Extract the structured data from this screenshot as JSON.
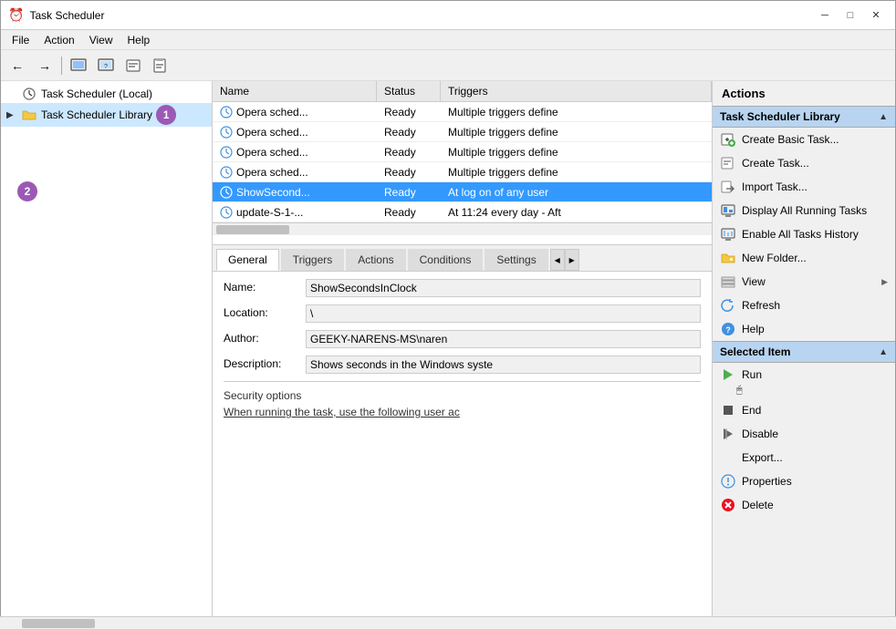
{
  "window": {
    "title": "Task Scheduler",
    "icon": "⏰"
  },
  "menu": {
    "items": [
      "File",
      "Action",
      "View",
      "Help"
    ]
  },
  "toolbar": {
    "back_label": "←",
    "forward_label": "→",
    "btn1": "📁",
    "btn2": "🔷",
    "btn3": "❓",
    "btn4": "📋"
  },
  "tree": {
    "items": [
      {
        "id": "local",
        "label": "Task Scheduler (Local)",
        "level": 0,
        "expandable": false,
        "icon": "clock"
      },
      {
        "id": "library",
        "label": "Task Scheduler Library",
        "level": 1,
        "expandable": true,
        "icon": "folder",
        "selected": true
      }
    ],
    "badge1": {
      "number": "1",
      "color": "#9b59b6"
    },
    "badge2": {
      "number": "2",
      "color": "#9b59b6"
    }
  },
  "tasks": {
    "columns": [
      "Name",
      "Status",
      "Triggers"
    ],
    "rows": [
      {
        "name": "Opera sched...",
        "status": "Ready",
        "triggers": "Multiple triggers define",
        "selected": false
      },
      {
        "name": "Opera sched...",
        "status": "Ready",
        "triggers": "Multiple triggers define",
        "selected": false
      },
      {
        "name": "Opera sched...",
        "status": "Ready",
        "triggers": "Multiple triggers define",
        "selected": false
      },
      {
        "name": "Opera sched...",
        "status": "Ready",
        "triggers": "Multiple triggers define",
        "selected": false
      },
      {
        "name": "ShowSecond...",
        "status": "Ready",
        "triggers": "At log on of any user",
        "selected": true
      },
      {
        "name": "update-S-1-...",
        "status": "Ready",
        "triggers": "At 11:24 every day - Aft",
        "selected": false
      }
    ]
  },
  "detail_tabs": {
    "tabs": [
      "General",
      "Triggers",
      "Actions",
      "Conditions",
      "Settings"
    ],
    "active": "General"
  },
  "detail": {
    "name_label": "Name:",
    "name_value": "ShowSecondsInClock",
    "location_label": "Location:",
    "location_value": "\\",
    "author_label": "Author:",
    "author_value": "GEEKY-NARENS-MS\\naren",
    "description_label": "Description:",
    "description_value": "Shows seconds in the Windows syste",
    "security_options_label": "Security options",
    "security_desc": "When running the task, use the following user ac"
  },
  "actions_panel": {
    "header": "Actions",
    "sections": [
      {
        "id": "library_section",
        "title": "Task Scheduler Library",
        "collapsed": false,
        "items": [
          {
            "id": "create_basic",
            "icon": "create_basic",
            "label": "Create Basic Task..."
          },
          {
            "id": "create_task",
            "icon": "create_task",
            "label": "Create Task..."
          },
          {
            "id": "import_task",
            "icon": "import_task",
            "label": "Import Task..."
          },
          {
            "id": "display_running",
            "icon": "display_running",
            "label": "Display All Running Tasks"
          },
          {
            "id": "enable_history",
            "icon": "enable_history",
            "label": "Enable All Tasks History"
          },
          {
            "id": "new_folder",
            "icon": "new_folder",
            "label": "New Folder..."
          },
          {
            "id": "view",
            "icon": "view",
            "label": "View",
            "has_arrow": true
          },
          {
            "id": "refresh",
            "icon": "refresh",
            "label": "Refresh"
          },
          {
            "id": "help",
            "icon": "help",
            "label": "Help"
          }
        ]
      },
      {
        "id": "selected_section",
        "title": "Selected Item",
        "collapsed": false,
        "items": [
          {
            "id": "run",
            "icon": "run",
            "label": "Run"
          },
          {
            "id": "end",
            "icon": "end",
            "label": "End"
          },
          {
            "id": "disable",
            "icon": "disable",
            "label": "Disable"
          },
          {
            "id": "export",
            "icon": "export",
            "label": "Export..."
          },
          {
            "id": "properties",
            "icon": "properties",
            "label": "Properties"
          },
          {
            "id": "delete",
            "icon": "delete",
            "label": "Delete"
          }
        ]
      }
    ]
  }
}
